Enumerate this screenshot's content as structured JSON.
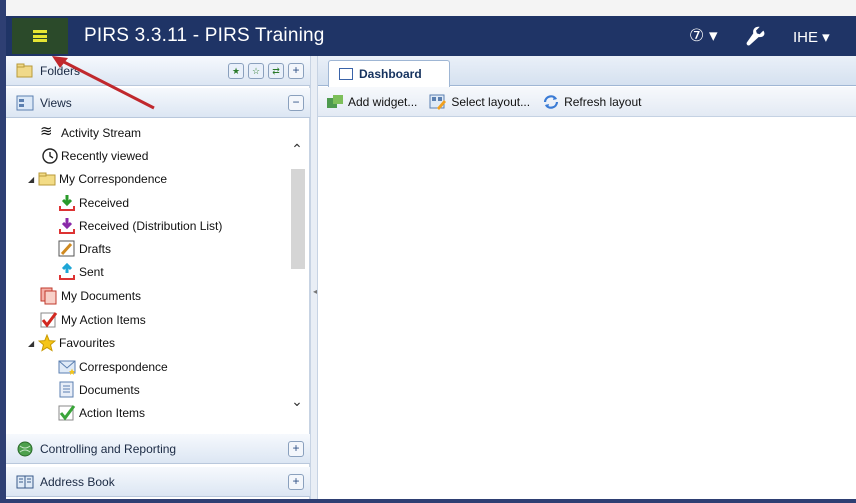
{
  "header": {
    "title": "PIRS 3.3.11  -  PIRS Training",
    "help_label": "⑦ ▾",
    "user_label": "IHE ▾"
  },
  "sidebar": {
    "folders_label": "Folders",
    "views_label": "Views",
    "views_collapse": "−",
    "items": [
      {
        "label": "Activity Stream"
      },
      {
        "label": "Recently viewed"
      },
      {
        "label": "My Correspondence"
      },
      {
        "label": "Received"
      },
      {
        "label": "Received (Distribution List)"
      },
      {
        "label": "Drafts"
      },
      {
        "label": "Sent"
      },
      {
        "label": "My Documents"
      },
      {
        "label": "My Action Items"
      },
      {
        "label": "Favourites"
      },
      {
        "label": "Correspondence"
      },
      {
        "label": "Documents"
      },
      {
        "label": "Action Items"
      }
    ],
    "controlling_label": "Controlling and Reporting",
    "address_label": "Address Book",
    "plus": "+"
  },
  "main": {
    "tab_label": "Dashboard",
    "toolbar": {
      "add_widget": "Add widget...",
      "select_layout": "Select layout...",
      "refresh_layout": "Refresh layout"
    }
  },
  "colors": {
    "header_bg": "#1f3466",
    "hamburger_bg": "#2b4a2a",
    "accent_yellow": "#e6e633",
    "annotation_arrow": "#c0282d"
  },
  "icons": [
    "hamburger-icon",
    "help-icon",
    "wrench-icon",
    "folder-icon",
    "views-icon",
    "activity-icon",
    "history-icon",
    "inbox-icon",
    "drafts-icon",
    "sent-icon",
    "documents-icon",
    "check-icon",
    "star-icon",
    "envelope-icon",
    "globe-icon",
    "book-icon",
    "dashboard-icon",
    "add-widget-icon",
    "layout-icon",
    "refresh-icon"
  ]
}
